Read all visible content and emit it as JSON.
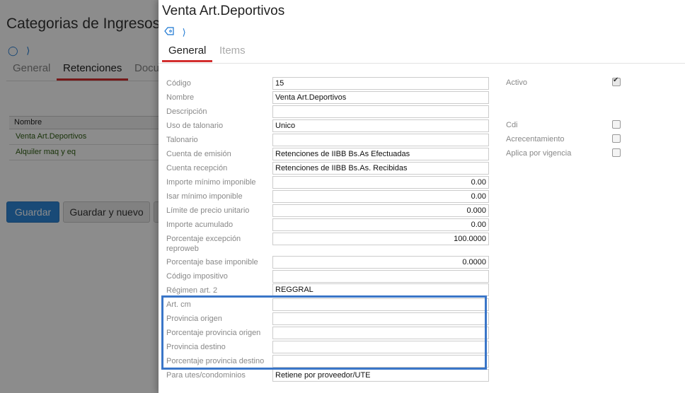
{
  "background": {
    "title": "Categorias de Ingresos B",
    "icons": [
      "tag-icon",
      "chevron-right-icon"
    ],
    "tabs": [
      "General",
      "Retenciones",
      "Docu"
    ],
    "active_tab": "Retenciones",
    "table": {
      "header": "Nombre",
      "rows": [
        "Venta Art.Deportivos",
        "Alquiler maq y eq"
      ]
    },
    "buttons": {
      "save": "Guardar",
      "save_new": "Guardar y nuevo"
    },
    "colors": {
      "primary_button": "#2f87d9",
      "tab_underline": "#d32f2f",
      "row_text": "#2e5d12"
    }
  },
  "dialog": {
    "title": "Venta Art.Deportivos",
    "icons": [
      "tag-icon",
      "chevron-right-icon"
    ],
    "tabs": [
      "General",
      "Items"
    ],
    "active_tab": "General",
    "fields": [
      {
        "label": "Código",
        "value": "15"
      },
      {
        "label": "Nombre",
        "value": "Venta Art.Deportivos"
      },
      {
        "label": "Descripción",
        "value": ""
      },
      {
        "label": "Uso de talonario",
        "value": "Unico"
      },
      {
        "label": "Talonario",
        "value": ""
      },
      {
        "label": "Cuenta de emisión",
        "value": "Retenciones de IIBB Bs.As Efectuadas"
      },
      {
        "label": "Cuenta recepción",
        "value": "Retenciones de IIBB Bs.As. Recibidas"
      },
      {
        "label": "Importe mínimo imponible",
        "value": "0.00"
      },
      {
        "label": "Isar mínimo imponible",
        "value": "0.00"
      },
      {
        "label": "Límite de precio unitario",
        "value": "0.000"
      },
      {
        "label": "Importe acumulado",
        "value": "0.00"
      },
      {
        "label": "Porcentaje excepción reproweb",
        "value": "100.0000"
      },
      {
        "label": "Porcentaje base imponible",
        "value": "0.0000"
      },
      {
        "label": "Código impositivo",
        "value": ""
      },
      {
        "label": "Régimen art. 2",
        "value": "REGGRAL"
      },
      {
        "label": "Art. cm",
        "value": ""
      },
      {
        "label": "Provincia origen",
        "value": ""
      },
      {
        "label": "Porcentaje provincia origen",
        "value": ""
      },
      {
        "label": "Provincia destino",
        "value": ""
      },
      {
        "label": "Porcentaje provincia destino",
        "value": ""
      },
      {
        "label": "Para utes/condominios",
        "value": "Retiene por proveedor/UTE"
      }
    ],
    "checkboxes": [
      {
        "label": "Activo",
        "checked": true
      },
      {
        "label": "Cdi",
        "checked": false
      },
      {
        "label": "Acrecentamiento",
        "checked": false
      },
      {
        "label": "Aplica por vigencia",
        "checked": false
      }
    ],
    "colors": {
      "highlight_border": "#3a76c8",
      "tab_underline": "#d32f2f",
      "icon": "#1976d2"
    }
  }
}
